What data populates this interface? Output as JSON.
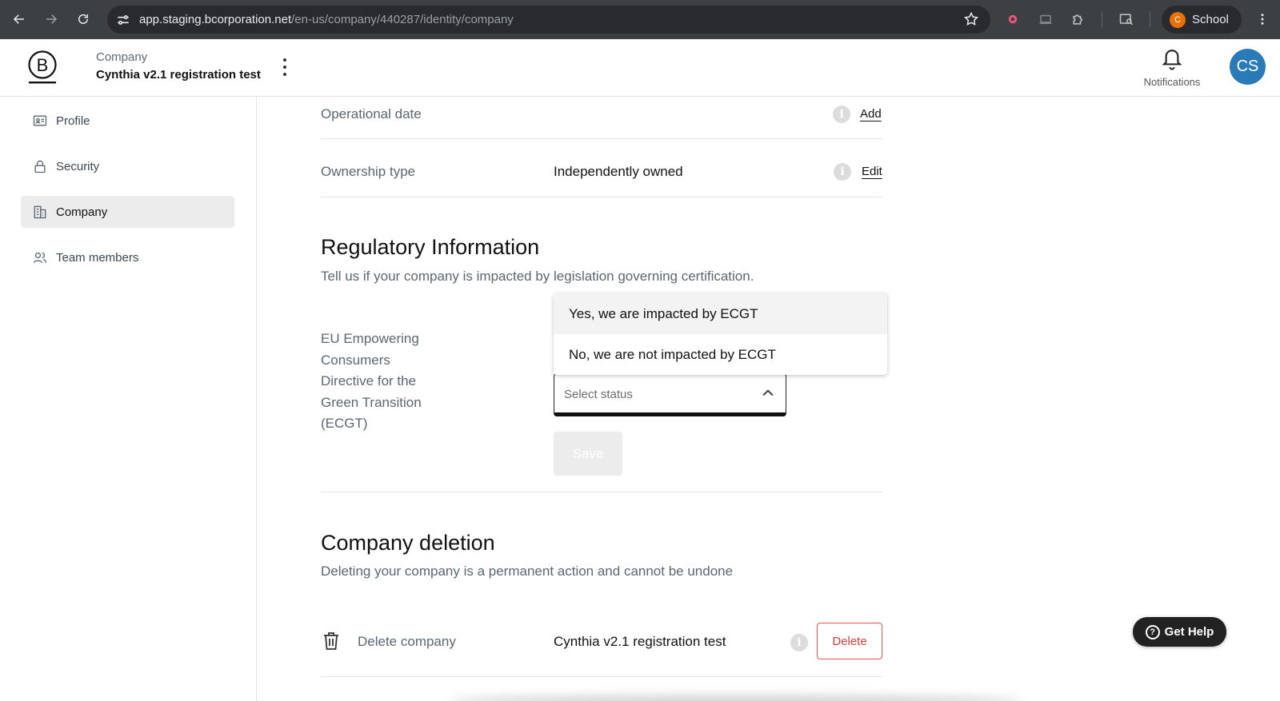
{
  "browser": {
    "url_host": "app.staging.bcorporation.net",
    "url_path": "/en-us/company/440287/identity/company",
    "profile_initial": "C",
    "profile_label": "School",
    "icons": [
      "back-icon",
      "forward-icon",
      "reload-icon",
      "site-settings-icon",
      "bookmark-star-icon",
      "extension-icon",
      "cast-icon",
      "extensions-puzzle-icon",
      "tab-search-icon",
      "chrome-menu-icon"
    ]
  },
  "header": {
    "eyebrow": "Company",
    "company_name": "Cynthia v2.1 registration test",
    "notifications_label": "Notifications",
    "avatar_initials": "CS"
  },
  "sidebar": {
    "items": [
      {
        "label": "Profile",
        "icon": "id-card-icon",
        "active": false
      },
      {
        "label": "Security",
        "icon": "lock-icon",
        "active": false
      },
      {
        "label": "Company",
        "icon": "building-icon",
        "active": true
      },
      {
        "label": "Team members",
        "icon": "people-icon",
        "active": false
      }
    ]
  },
  "fields": {
    "operational_date": {
      "label": "Operational date",
      "value": "",
      "action": "Add"
    },
    "ownership_type": {
      "label": "Ownership type",
      "value": "Independently owned",
      "action": "Edit"
    }
  },
  "regulatory": {
    "title": "Regulatory Information",
    "subtitle": "Tell us if your company is impacted by legislation governing certification.",
    "ecgt_label": "EU Empowering Consumers Directive for the Green Transition (ECGT)",
    "select_placeholder": "Select status",
    "options": [
      "Yes, we are impacted by ECGT",
      "No, we are not impacted by ECGT"
    ],
    "save_label": "Save"
  },
  "deletion": {
    "title": "Company deletion",
    "subtitle": "Deleting your company is a permanent action and cannot be undone",
    "row_label": "Delete company",
    "row_value": "Cynthia v2.1 registration test",
    "button_label": "Delete"
  },
  "help": {
    "label": "Get Help"
  },
  "colors": {
    "chrome_bg": "#3c4043",
    "avatar": "#2a7ab8",
    "danger": "#d93b3b",
    "sidebar_active": "#ececec"
  }
}
